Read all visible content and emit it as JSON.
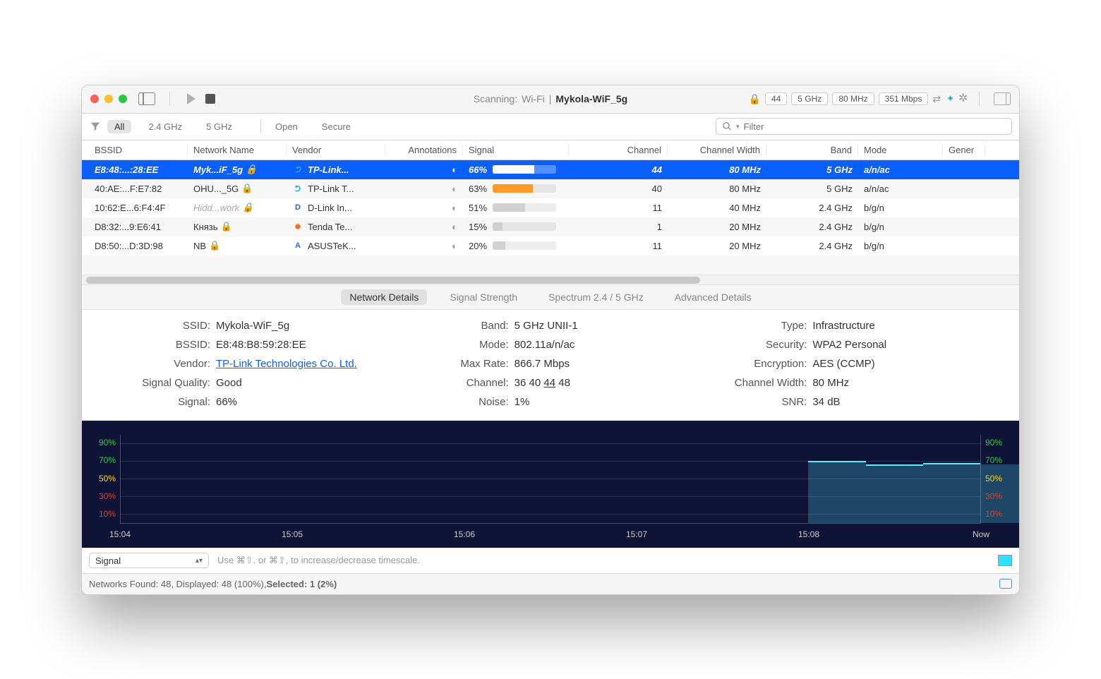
{
  "titlebar": {
    "scanning_label": "Scanning:",
    "interface": "Wi-Fi",
    "network": "Mykola-WiF_5g",
    "badges": [
      "44",
      "5 GHz",
      "80 MHz",
      "351 Mbps"
    ]
  },
  "filterbar": {
    "segments": [
      "All",
      "2.4 GHz",
      "5 GHz"
    ],
    "segments2": [
      "Open",
      "Secure"
    ],
    "active": "All",
    "search_placeholder": "Filter"
  },
  "columns": [
    "BSSID",
    "Network Name",
    "Vendor",
    "Annotations",
    "Signal",
    "Channel",
    "Channel Width",
    "Band",
    "Mode",
    "Gener"
  ],
  "rows": [
    {
      "color": "#2de0ff",
      "bssid": "E8:48:...:28:EE",
      "name": "Myk...iF_5g",
      "secured": true,
      "vendor": "TP-Link...",
      "vicon": "tplink",
      "signal": 66,
      "barcolor": "#ffffff",
      "channel": "44",
      "width": "80 MHz",
      "band": "5 GHz",
      "mode": "a/n/ac",
      "selected": true
    },
    {
      "color": "#7cff22",
      "bssid": "40:AE:...F:E7:82",
      "name": "OHU..._5G",
      "secured": true,
      "vendor": "TP-Link T...",
      "vicon": "tplink",
      "signal": 63,
      "barcolor": "#ff9a2a",
      "channel": "40",
      "width": "80 MHz",
      "band": "5 GHz",
      "mode": "a/n/ac",
      "selected": false
    },
    {
      "color": "#ff8a2a",
      "bssid": "10:62:E...6:F4:4F",
      "name": "Hidd...work",
      "namestyle": "italic faded",
      "secured": true,
      "vendor": "D-Link In...",
      "vicon": "dlink",
      "signal": 51,
      "barcolor": "#d0d0d0",
      "channel": "11",
      "width": "40 MHz",
      "band": "2.4 GHz",
      "mode": "b/g/n",
      "selected": false
    },
    {
      "color": "#ff2a2a",
      "bssid": "D8:32:...9:E6:41",
      "name": "Князь",
      "secured": true,
      "vendor": "Tenda Te...",
      "vicon": "tenda",
      "signal": 15,
      "barcolor": "#d0d0d0",
      "channel": "1",
      "width": "20 MHz",
      "band": "2.4 GHz",
      "mode": "b/g/n",
      "selected": false
    },
    {
      "color": "#ffee2a",
      "bssid": "D8:50:...D:3D:98",
      "name": "NB",
      "secured": true,
      "vendor": "ASUSTeK...",
      "vicon": "asus",
      "signal": 20,
      "barcolor": "#d0d0d0",
      "channel": "11",
      "width": "20 MHz",
      "band": "2.4 GHz",
      "mode": "b/g/n",
      "selected": false
    },
    {
      "color": "#48ff48",
      "bssid": "",
      "name": "",
      "secured": false,
      "vendor": "",
      "vicon": "",
      "signal": null,
      "barcolor": "",
      "channel": "",
      "width": "",
      "band": "",
      "mode": "",
      "selected": false
    }
  ],
  "detail_tabs": {
    "items": [
      "Network Details",
      "Signal Strength",
      "Spectrum 2.4 / 5 GHz",
      "Advanced Details"
    ],
    "active": "Network Details"
  },
  "details": {
    "col1": [
      {
        "label": "SSID:",
        "value": "Mykola-WiF_5g"
      },
      {
        "label": "BSSID:",
        "value": "E8:48:B8:59:28:EE"
      },
      {
        "label": "Vendor:",
        "value": "TP-Link Technologies Co. Ltd.",
        "link": true
      },
      {
        "label": "Signal Quality:",
        "value": "Good"
      },
      {
        "label": "Signal:",
        "value": "66%"
      }
    ],
    "col2": [
      {
        "label": "Band:",
        "value": "5 GHz UNII-1"
      },
      {
        "label": "Mode:",
        "value": "802.11a/n/ac"
      },
      {
        "label": "Max Rate:",
        "value": "866.7 Mbps"
      },
      {
        "label": "Channel:",
        "value": "36 40 44 48",
        "underline_index": 2
      },
      {
        "label": "Noise:",
        "value": "1%"
      }
    ],
    "col3": [
      {
        "label": "Type:",
        "value": "Infrastructure"
      },
      {
        "label": "Security:",
        "value": "WPA2 Personal"
      },
      {
        "label": "Encryption:",
        "value": "AES (CCMP)"
      },
      {
        "label": "Channel Width:",
        "value": "80 MHz"
      },
      {
        "label": "SNR:",
        "value": "34 dB"
      }
    ]
  },
  "chart_data": {
    "type": "line",
    "ylim": [
      0,
      100
    ],
    "yticks": [
      {
        "v": 90,
        "color": "#2ecc40"
      },
      {
        "v": 70,
        "color": "#2ecc40"
      },
      {
        "v": 50,
        "color": "#ffd800"
      },
      {
        "v": 30,
        "color": "#d84030"
      },
      {
        "v": 10,
        "color": "#d84030"
      }
    ],
    "xticks": [
      "15:04",
      "15:05",
      "15:06",
      "15:07",
      "15:08",
      "Now"
    ],
    "series": [
      {
        "name": "Signal",
        "color": "#5fe8ff",
        "values": [
          null,
          null,
          null,
          null,
          70,
          66,
          68,
          66
        ]
      }
    ],
    "title": "",
    "xlabel": "",
    "ylabel": ""
  },
  "chart_footer": {
    "selector": "Signal",
    "hint": "Use ⌘⇧. or ⌘⇧, to increase/decrease timescale."
  },
  "statusbar": {
    "text_prefix": "Networks Found: 48, Displayed: 48 (100%), ",
    "selected": "Selected: 1 (2%)"
  }
}
